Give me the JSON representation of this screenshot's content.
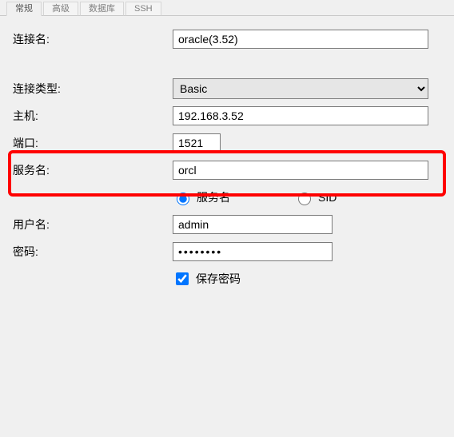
{
  "tabs": {
    "t0": "常规",
    "t1": "高级",
    "t2": "数据库",
    "t3": "SSH"
  },
  "form": {
    "conn_name_label": "连接名:",
    "conn_name_value": "oracle(3.52)",
    "conn_type_label": "连接类型:",
    "conn_type_value": "Basic",
    "host_label": "主机:",
    "host_value": "192.168.3.52",
    "port_label": "端口:",
    "port_value": "1521",
    "service_label": "服务名:",
    "service_value": "orcl",
    "radio_service": "服务名",
    "radio_sid": "SID",
    "user_label": "用户名:",
    "user_value": "admin",
    "password_label": "密码:",
    "password_value": "••••••••",
    "save_pw_label": "保存密码"
  }
}
